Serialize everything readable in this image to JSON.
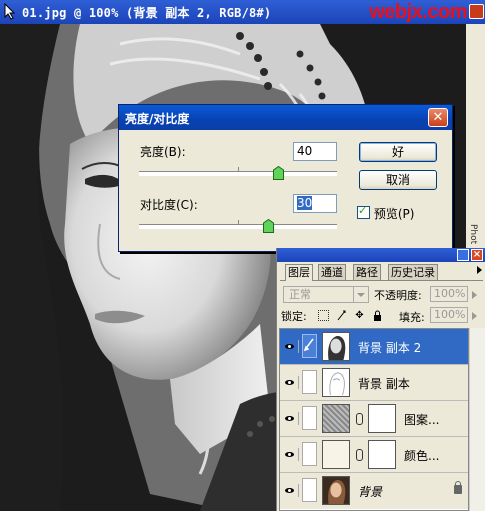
{
  "document": {
    "title": "01.jpg @ 100% (背景 副本 2, RGB/8#)",
    "watermark": "webjx.com",
    "side_label": "Phot"
  },
  "dialog": {
    "title": "亮度/对比度",
    "brightness_label": "亮度(B):",
    "brightness_value": "40",
    "contrast_label": "对比度(C):",
    "contrast_value": "30",
    "ok_label": "好",
    "cancel_label": "取消",
    "preview_label": "预览(P)",
    "preview_checked": true,
    "brightness_slider_fraction": 0.7,
    "contrast_slider_fraction": 0.65
  },
  "layers_panel": {
    "tabs": [
      {
        "label": "图层",
        "active": true
      },
      {
        "label": "通道",
        "active": false
      },
      {
        "label": "路径",
        "active": false
      },
      {
        "label": "历史记录",
        "active": false
      }
    ],
    "blend_mode": "正常",
    "opacity_label": "不透明度:",
    "opacity_value": "100%",
    "lock_label": "锁定:",
    "fill_label": "填充:",
    "fill_value": "100%",
    "layers": [
      {
        "name": "背景 副本 2",
        "selected": true,
        "visible": true
      },
      {
        "name": "背景 副本",
        "selected": false,
        "visible": true
      },
      {
        "name": "图案...",
        "selected": false,
        "visible": true
      },
      {
        "name": "颜色...",
        "selected": false,
        "visible": true
      },
      {
        "name": "背景",
        "selected": false,
        "visible": true,
        "locked": true
      }
    ]
  },
  "colors": {
    "title_blue": "#1c44b8",
    "selection_blue": "#316ac5",
    "dialog_bg": "#ece9d8",
    "watermark_red": "#e8101e"
  }
}
